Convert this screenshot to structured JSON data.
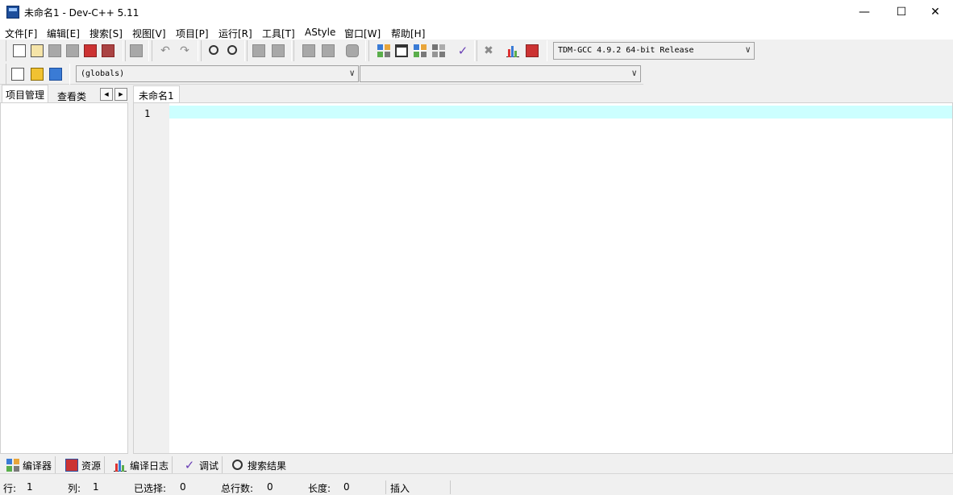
{
  "window": {
    "title": "未命名1 - Dev-C++ 5.11",
    "minimize_glyph": "—",
    "maximize_glyph": "☐",
    "close_glyph": "✕"
  },
  "menu": [
    "文件[F]",
    "编辑[E]",
    "搜索[S]",
    "视图[V]",
    "项目[P]",
    "运行[R]",
    "工具[T]",
    "AStyle",
    "窗口[W]",
    "帮助[H]"
  ],
  "toolbar": {
    "compiler": "TDM-GCC 4.9.2 64-bit Release",
    "class_combo": "(globals)",
    "member_combo": ""
  },
  "left_panel": {
    "tabs": [
      "项目管理",
      "查看类"
    ]
  },
  "editor": {
    "tab": "未命名1",
    "line_numbers": [
      "1"
    ]
  },
  "bottom_tabs": [
    "编译器",
    "资源",
    "编译日志",
    "调试",
    "搜索结果"
  ],
  "status": {
    "row_label": "行:",
    "row_value": "1",
    "col_label": "列:",
    "col_value": "1",
    "sel_label": "已选择:",
    "sel_value": "0",
    "lines_label": "总行数:",
    "lines_value": "0",
    "len_label": "长度:",
    "len_value": "0",
    "mode": "插入"
  },
  "colors": {
    "current_line": "#ccffff",
    "gutter": "#f0f0f0"
  }
}
